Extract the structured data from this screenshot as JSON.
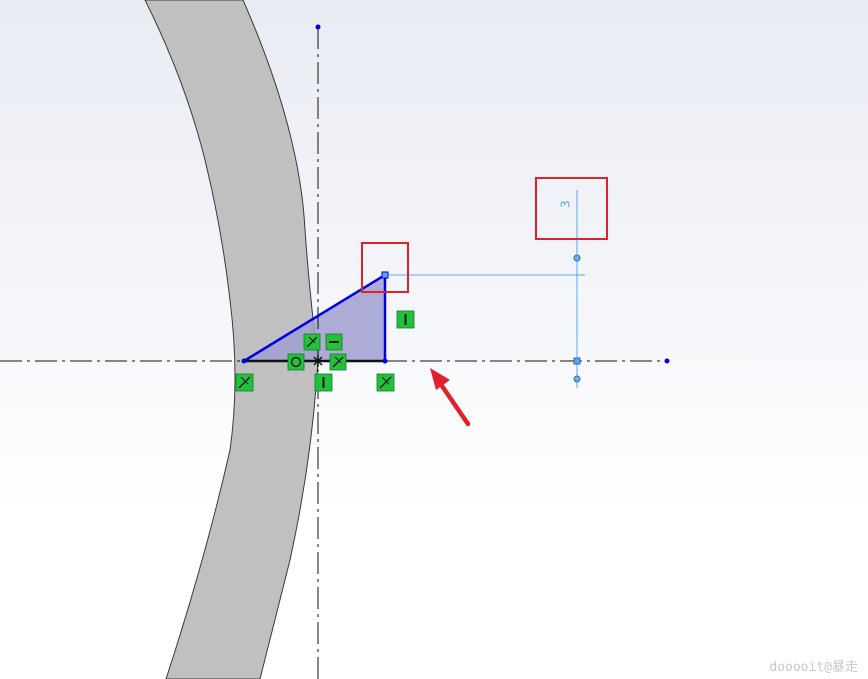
{
  "viewport": {
    "background_top": "#e9ecf3",
    "background_bottom": "#ffffff"
  },
  "colors": {
    "ring_fill": "#c0c0c0",
    "ring_stroke": "#3a3a3a",
    "sketch_line": "#0000e6",
    "triangle_fill": "#9f9fcf",
    "centerline": "#111111",
    "dimension": "#5aa6e8",
    "relation_badge": "#22c23a",
    "highlight_box": "#e0202a",
    "arrow": "#e0202a"
  },
  "dimension": {
    "value": "3"
  },
  "relations": [
    {
      "icon": "coincident-icon"
    },
    {
      "icon": "horizontal-icon"
    },
    {
      "icon": "coincident-icon"
    },
    {
      "icon": "coincident-icon"
    },
    {
      "icon": "vertical-icon"
    },
    {
      "icon": "vertical-icon"
    },
    {
      "icon": "coincident-icon"
    },
    {
      "icon": "coincident-icon"
    },
    {
      "icon": "concentric-icon"
    }
  ],
  "watermark": {
    "text": "dooooit@暴走"
  }
}
